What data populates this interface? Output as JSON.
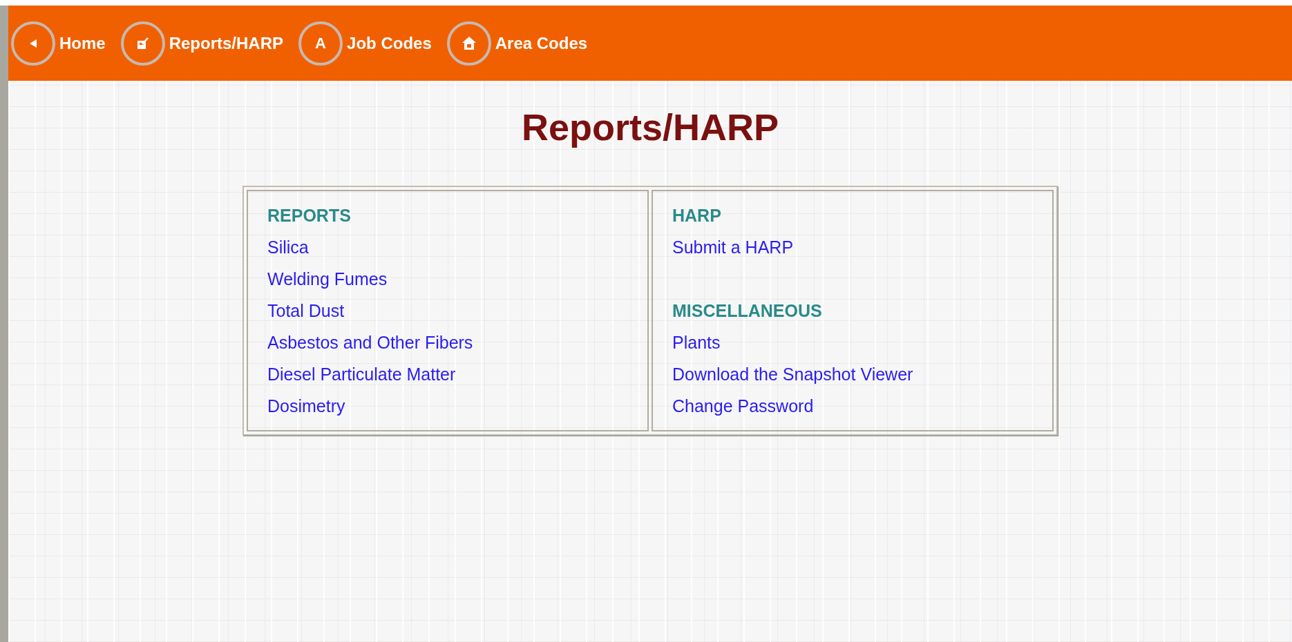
{
  "nav": [
    {
      "kind": "back",
      "label": "Home"
    },
    {
      "kind": "edit",
      "label": "Reports/HARP"
    },
    {
      "kind": "letter",
      "glyph": "A",
      "label": "Job Codes"
    },
    {
      "kind": "house",
      "label": "Area Codes"
    }
  ],
  "title": "Reports/HARP",
  "columns": [
    {
      "sections": [
        {
          "heading": "REPORTS",
          "links": [
            "Silica",
            "Welding Fumes",
            "Total Dust",
            "Asbestos and Other Fibers",
            "Diesel Particulate Matter",
            "Dosimetry"
          ]
        }
      ]
    },
    {
      "sections": [
        {
          "heading": "HARP",
          "links": [
            "Submit a HARP"
          ]
        },
        {
          "heading": "MISCELLANEOUS",
          "links": [
            "Plants",
            "Download the Snapshot Viewer",
            "Change Password"
          ]
        }
      ]
    }
  ]
}
